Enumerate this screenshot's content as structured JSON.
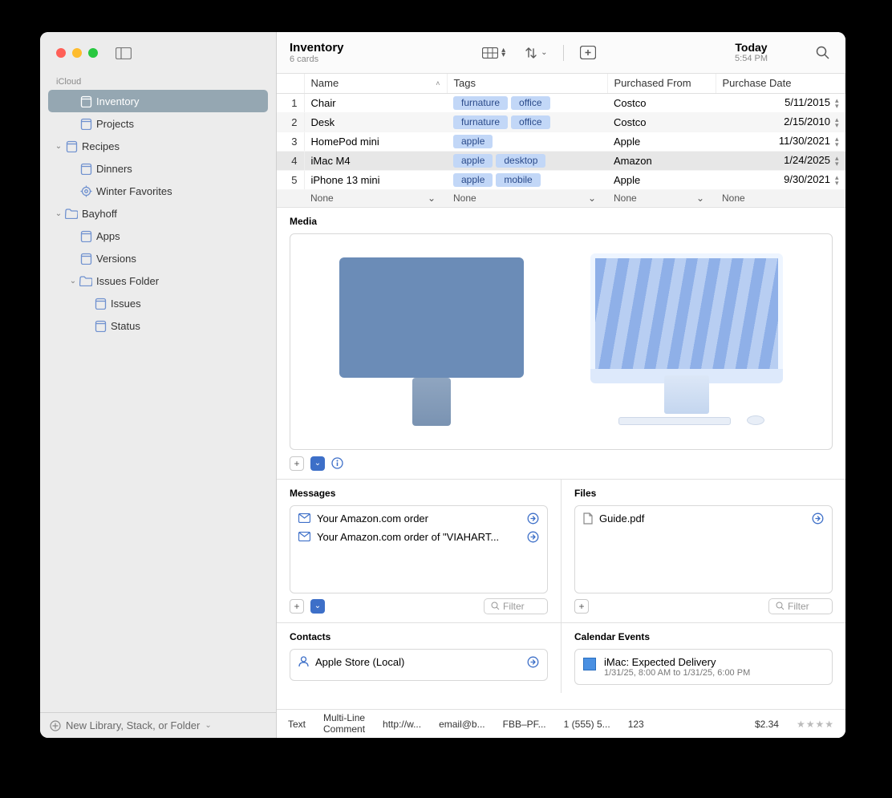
{
  "sidebar": {
    "section": "iCloud",
    "items": [
      {
        "label": "Inventory",
        "icon": "stack",
        "indent": 1,
        "selected": true
      },
      {
        "label": "Projects",
        "icon": "stack",
        "indent": 1
      },
      {
        "label": "Recipes",
        "icon": "stack",
        "indent": 0,
        "disclosure": "open"
      },
      {
        "label": "Dinners",
        "icon": "stack",
        "indent": 1
      },
      {
        "label": "Winter Favorites",
        "icon": "gear",
        "indent": 1
      },
      {
        "label": "Bayhoff",
        "icon": "folder",
        "indent": 0,
        "disclosure": "open"
      },
      {
        "label": "Apps",
        "icon": "stack",
        "indent": 1
      },
      {
        "label": "Versions",
        "icon": "stack",
        "indent": 1
      },
      {
        "label": "Issues Folder",
        "icon": "folder",
        "indent": 1,
        "disclosure": "open"
      },
      {
        "label": "Issues",
        "icon": "stack",
        "indent": 2
      },
      {
        "label": "Status",
        "icon": "stack",
        "indent": 2
      }
    ],
    "footer": "New Library, Stack, or Folder"
  },
  "toolbar": {
    "title": "Inventory",
    "subtitle": "6 cards",
    "date_top": "Today",
    "date_sub": "5:54 PM"
  },
  "columns": [
    "Name",
    "Tags",
    "Purchased From",
    "Purchase Date"
  ],
  "rows": [
    {
      "idx": "1",
      "name": "Chair",
      "tags": [
        "furnature",
        "office"
      ],
      "from": "Costco",
      "date": "5/11/2015"
    },
    {
      "idx": "2",
      "name": "Desk",
      "tags": [
        "furnature",
        "office"
      ],
      "from": "Costco",
      "date": "2/15/2010"
    },
    {
      "idx": "3",
      "name": "HomePod mini",
      "tags": [
        "apple"
      ],
      "from": "Apple",
      "date": "11/30/2021"
    },
    {
      "idx": "4",
      "name": "iMac M4",
      "tags": [
        "apple",
        "desktop"
      ],
      "from": "Amazon",
      "date": "1/24/2025",
      "selected": true
    },
    {
      "idx": "5",
      "name": "iPhone 13 mini",
      "tags": [
        "apple",
        "mobile"
      ],
      "from": "Apple",
      "date": "9/30/2021"
    }
  ],
  "filter_label": "None",
  "sections": {
    "media": "Media",
    "messages": "Messages",
    "files": "Files",
    "contacts": "Contacts",
    "calendar": "Calendar Events"
  },
  "messages": [
    {
      "label": "Your Amazon.com order"
    },
    {
      "label": "Your Amazon.com order of \"VIAHART..."
    }
  ],
  "files": [
    {
      "label": "Guide.pdf"
    }
  ],
  "contacts": [
    {
      "label": "Apple Store (Local)"
    }
  ],
  "events": [
    {
      "title": "iMac: Expected Delivery",
      "sub": "1/31/25, 8:00 AM to 1/31/25, 6:00 PM"
    }
  ],
  "filter_placeholder": "Filter",
  "footer": {
    "text": "Text",
    "multi1": "Multi-Line",
    "multi2": "Comment",
    "url": "http://w...",
    "email": "email@b...",
    "code": "FBB–PF...",
    "phone": "1 (555) 5...",
    "num": "123",
    "money": "$2.34",
    "stars": "★★★★"
  }
}
